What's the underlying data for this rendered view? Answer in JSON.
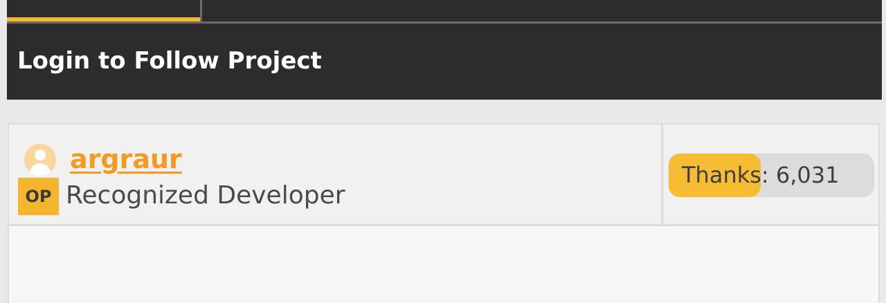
{
  "tabs": {
    "active_index": 0
  },
  "follow_bar": {
    "label": "Login to Follow Project"
  },
  "post": {
    "author": {
      "username": "argraur",
      "badge": "OP",
      "role": "Recognized Developer",
      "avatar_icon": "user-avatar-icon"
    },
    "thanks": {
      "label": "Thanks:",
      "count": "6,031"
    }
  },
  "colors": {
    "accent": "#f6b52e",
    "username": "#f29a21",
    "dark_bar": "#2c2c2c"
  }
}
